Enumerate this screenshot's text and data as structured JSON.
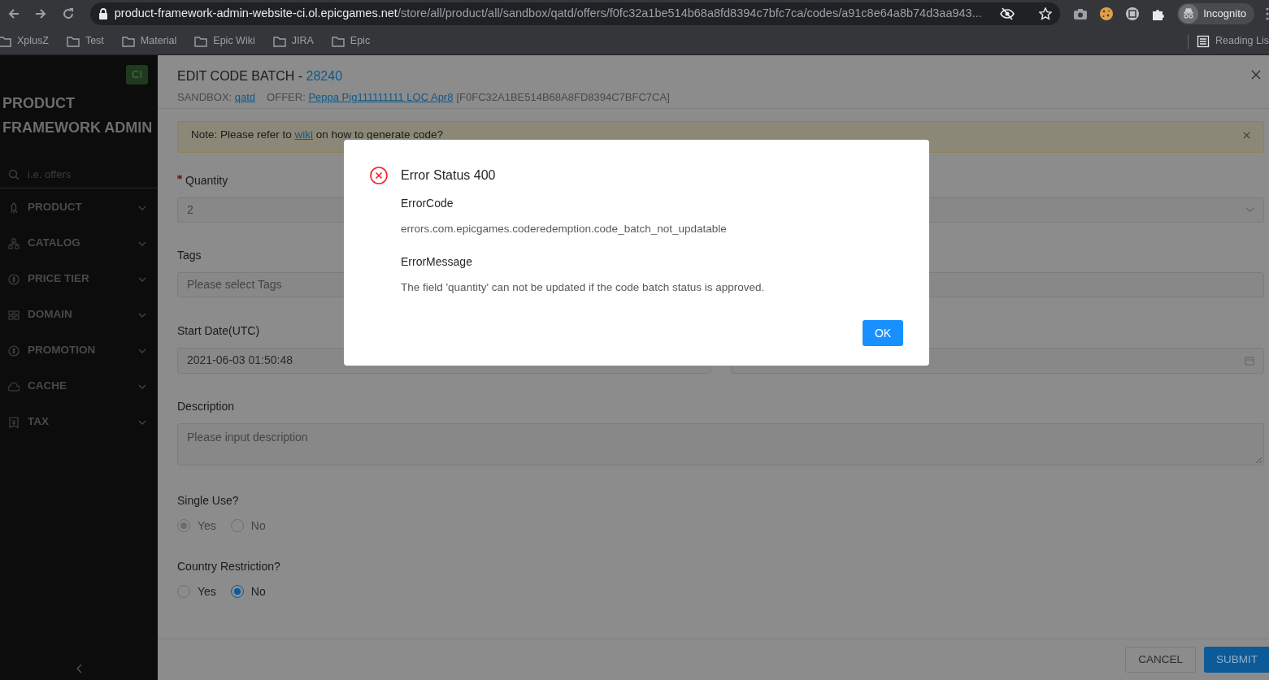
{
  "browser": {
    "url_host": "product-framework-admin-website-ci.ol.epicgames.net",
    "url_path": "/store/all/product/all/sandbox/qatd/offers/f0fc32a1be514b68a8fd8394c7bfc7ca/codes/a91c8e64a8b74d3aa943...",
    "profile": "Incognito",
    "bookmarks": [
      "XplusZ",
      "Test",
      "Material",
      "Epic Wiki",
      "JIRA",
      "Epic"
    ],
    "reading_list": "Reading Lis"
  },
  "sidebar": {
    "badge": "CI",
    "title_lines": [
      "PRODUCT",
      "FRAMEWORK ADMIN"
    ],
    "search_placeholder": "i.e. offers",
    "items": [
      {
        "label": "PRODUCT"
      },
      {
        "label": "CATALOG"
      },
      {
        "label": "PRICE TIER"
      },
      {
        "label": "DOMAIN"
      },
      {
        "label": "PROMOTION"
      },
      {
        "label": "CACHE"
      },
      {
        "label": "TAX"
      }
    ]
  },
  "header": {
    "title": "EDIT CODE BATCH - ",
    "batch_id": "28240",
    "sandbox_label": "SANDBOX:",
    "sandbox": "qatd",
    "offer_label": "OFFER:",
    "offer_name": "Peppa Pig111111111 LOC Apr8",
    "offer_id": "[F0FC32A1BE514B68A8FD8394C7BFC7CA]"
  },
  "note": {
    "link": "wiki",
    "before": "Note: Please refer to ",
    "after": " on how to generate code?"
  },
  "form": {
    "quantity": {
      "label": "Quantity",
      "required": true,
      "value": "2",
      "disabled": true
    },
    "tags": {
      "label": "Tags",
      "placeholder": "Please select Tags"
    },
    "start_date": {
      "label": "Start Date(UTC)",
      "value": "2021-06-03 01:50:48"
    },
    "description": {
      "label": "Description",
      "placeholder": "Please input description"
    },
    "single_use": {
      "label": "Single Use?",
      "disabled": true,
      "options": [
        {
          "label": "Yes",
          "selected": true
        },
        {
          "label": "No",
          "selected": false
        }
      ]
    },
    "country_restriction": {
      "label": "Country Restriction?",
      "disabled": false,
      "options": [
        {
          "label": "Yes",
          "selected": false
        },
        {
          "label": "No",
          "selected": true
        }
      ]
    }
  },
  "footer": {
    "cancel": "CANCEL",
    "submit": "SUBMIT"
  },
  "modal": {
    "title": "Error Status 400",
    "sections": [
      {
        "heading": "ErrorCode",
        "text": "errors.com.epicgames.coderedemption.code_batch_not_updatable"
      },
      {
        "heading": "ErrorMessage",
        "text": "The field 'quantity' can not be updated if the code batch status is approved."
      }
    ],
    "ok": "OK"
  }
}
